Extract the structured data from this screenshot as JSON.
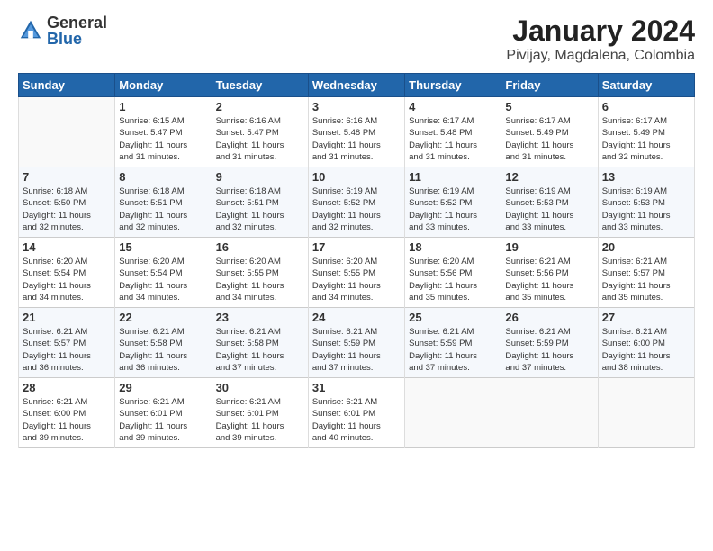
{
  "logo": {
    "general": "General",
    "blue": "Blue"
  },
  "header": {
    "month": "January 2024",
    "location": "Pivijay, Magdalena, Colombia"
  },
  "weekdays": [
    "Sunday",
    "Monday",
    "Tuesday",
    "Wednesday",
    "Thursday",
    "Friday",
    "Saturday"
  ],
  "weeks": [
    [
      {
        "day": "",
        "info": ""
      },
      {
        "day": "1",
        "info": "Sunrise: 6:15 AM\nSunset: 5:47 PM\nDaylight: 11 hours\nand 31 minutes."
      },
      {
        "day": "2",
        "info": "Sunrise: 6:16 AM\nSunset: 5:47 PM\nDaylight: 11 hours\nand 31 minutes."
      },
      {
        "day": "3",
        "info": "Sunrise: 6:16 AM\nSunset: 5:48 PM\nDaylight: 11 hours\nand 31 minutes."
      },
      {
        "day": "4",
        "info": "Sunrise: 6:17 AM\nSunset: 5:48 PM\nDaylight: 11 hours\nand 31 minutes."
      },
      {
        "day": "5",
        "info": "Sunrise: 6:17 AM\nSunset: 5:49 PM\nDaylight: 11 hours\nand 31 minutes."
      },
      {
        "day": "6",
        "info": "Sunrise: 6:17 AM\nSunset: 5:49 PM\nDaylight: 11 hours\nand 32 minutes."
      }
    ],
    [
      {
        "day": "7",
        "info": "Sunrise: 6:18 AM\nSunset: 5:50 PM\nDaylight: 11 hours\nand 32 minutes."
      },
      {
        "day": "8",
        "info": "Sunrise: 6:18 AM\nSunset: 5:51 PM\nDaylight: 11 hours\nand 32 minutes."
      },
      {
        "day": "9",
        "info": "Sunrise: 6:18 AM\nSunset: 5:51 PM\nDaylight: 11 hours\nand 32 minutes."
      },
      {
        "day": "10",
        "info": "Sunrise: 6:19 AM\nSunset: 5:52 PM\nDaylight: 11 hours\nand 32 minutes."
      },
      {
        "day": "11",
        "info": "Sunrise: 6:19 AM\nSunset: 5:52 PM\nDaylight: 11 hours\nand 33 minutes."
      },
      {
        "day": "12",
        "info": "Sunrise: 6:19 AM\nSunset: 5:53 PM\nDaylight: 11 hours\nand 33 minutes."
      },
      {
        "day": "13",
        "info": "Sunrise: 6:19 AM\nSunset: 5:53 PM\nDaylight: 11 hours\nand 33 minutes."
      }
    ],
    [
      {
        "day": "14",
        "info": "Sunrise: 6:20 AM\nSunset: 5:54 PM\nDaylight: 11 hours\nand 34 minutes."
      },
      {
        "day": "15",
        "info": "Sunrise: 6:20 AM\nSunset: 5:54 PM\nDaylight: 11 hours\nand 34 minutes."
      },
      {
        "day": "16",
        "info": "Sunrise: 6:20 AM\nSunset: 5:55 PM\nDaylight: 11 hours\nand 34 minutes."
      },
      {
        "day": "17",
        "info": "Sunrise: 6:20 AM\nSunset: 5:55 PM\nDaylight: 11 hours\nand 34 minutes."
      },
      {
        "day": "18",
        "info": "Sunrise: 6:20 AM\nSunset: 5:56 PM\nDaylight: 11 hours\nand 35 minutes."
      },
      {
        "day": "19",
        "info": "Sunrise: 6:21 AM\nSunset: 5:56 PM\nDaylight: 11 hours\nand 35 minutes."
      },
      {
        "day": "20",
        "info": "Sunrise: 6:21 AM\nSunset: 5:57 PM\nDaylight: 11 hours\nand 35 minutes."
      }
    ],
    [
      {
        "day": "21",
        "info": "Sunrise: 6:21 AM\nSunset: 5:57 PM\nDaylight: 11 hours\nand 36 minutes."
      },
      {
        "day": "22",
        "info": "Sunrise: 6:21 AM\nSunset: 5:58 PM\nDaylight: 11 hours\nand 36 minutes."
      },
      {
        "day": "23",
        "info": "Sunrise: 6:21 AM\nSunset: 5:58 PM\nDaylight: 11 hours\nand 37 minutes."
      },
      {
        "day": "24",
        "info": "Sunrise: 6:21 AM\nSunset: 5:59 PM\nDaylight: 11 hours\nand 37 minutes."
      },
      {
        "day": "25",
        "info": "Sunrise: 6:21 AM\nSunset: 5:59 PM\nDaylight: 11 hours\nand 37 minutes."
      },
      {
        "day": "26",
        "info": "Sunrise: 6:21 AM\nSunset: 5:59 PM\nDaylight: 11 hours\nand 37 minutes."
      },
      {
        "day": "27",
        "info": "Sunrise: 6:21 AM\nSunset: 6:00 PM\nDaylight: 11 hours\nand 38 minutes."
      }
    ],
    [
      {
        "day": "28",
        "info": "Sunrise: 6:21 AM\nSunset: 6:00 PM\nDaylight: 11 hours\nand 39 minutes."
      },
      {
        "day": "29",
        "info": "Sunrise: 6:21 AM\nSunset: 6:01 PM\nDaylight: 11 hours\nand 39 minutes."
      },
      {
        "day": "30",
        "info": "Sunrise: 6:21 AM\nSunset: 6:01 PM\nDaylight: 11 hours\nand 39 minutes."
      },
      {
        "day": "31",
        "info": "Sunrise: 6:21 AM\nSunset: 6:01 PM\nDaylight: 11 hours\nand 40 minutes."
      },
      {
        "day": "",
        "info": ""
      },
      {
        "day": "",
        "info": ""
      },
      {
        "day": "",
        "info": ""
      }
    ]
  ]
}
